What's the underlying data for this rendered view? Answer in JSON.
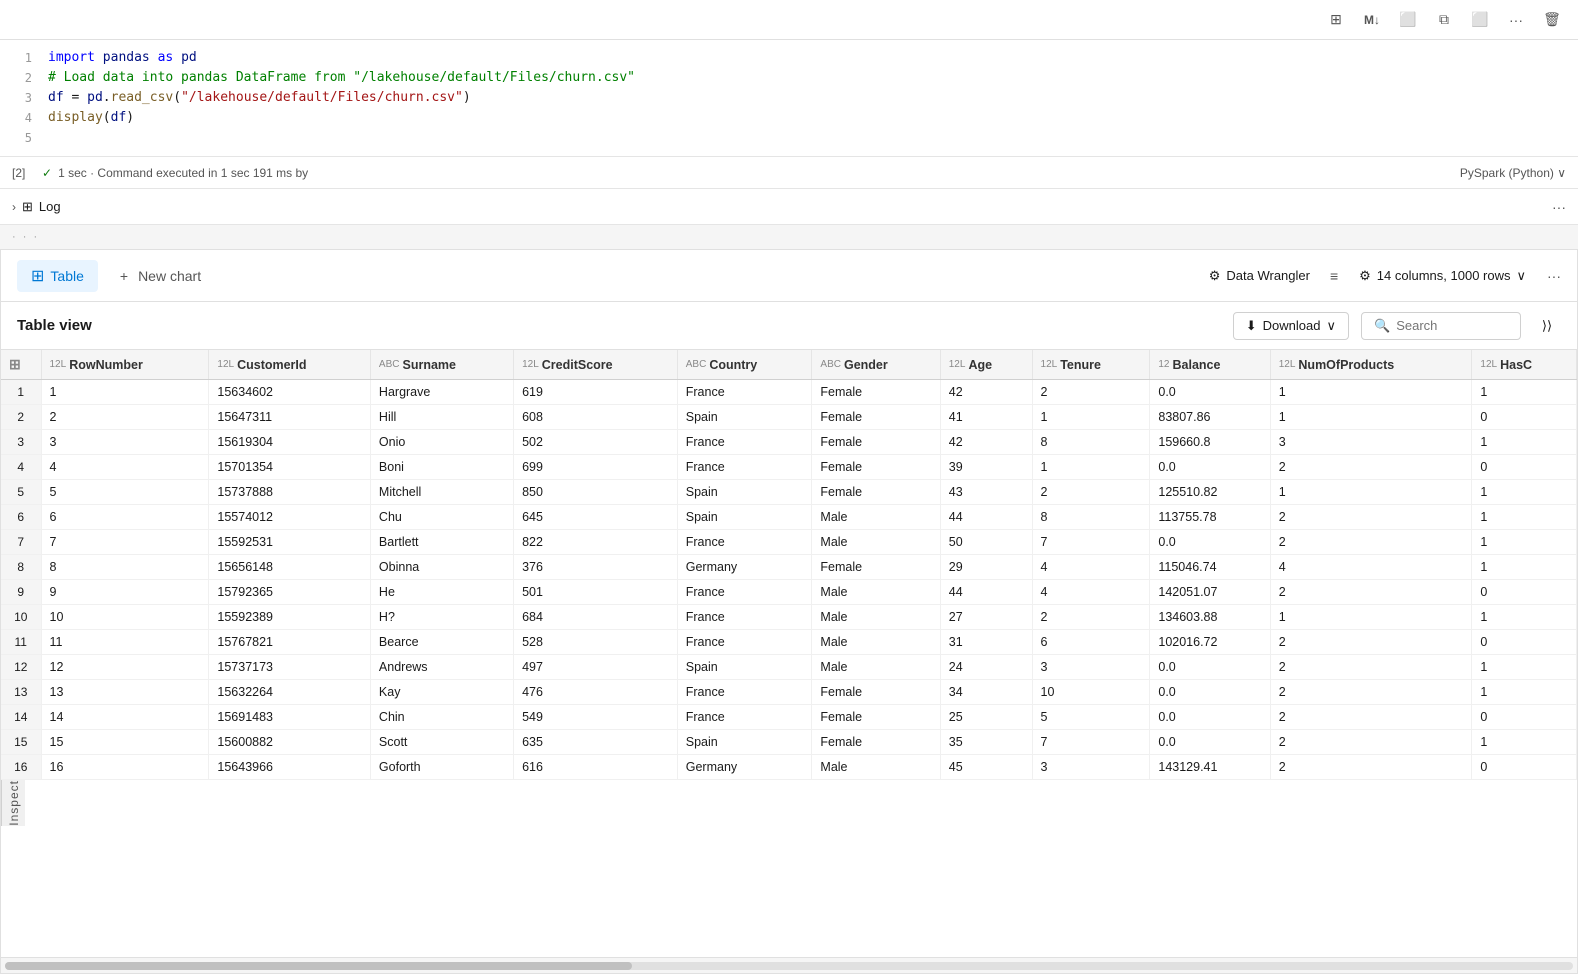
{
  "toolbar": {
    "icons": [
      "⊞",
      "Μ↓",
      "□",
      "⧉",
      "□→",
      "···",
      "🗑"
    ]
  },
  "cell": {
    "number": "[2]",
    "status": "✓  1 sec · Command executed in 1 sec 191 ms by",
    "pyspark": "PySpark (Python)  ∨",
    "lines": [
      {
        "num": 1,
        "tokens": [
          {
            "t": "kw",
            "v": "import "
          },
          {
            "t": "var",
            "v": "pandas"
          },
          {
            "t": "kw",
            "v": " as "
          },
          {
            "t": "var",
            "v": "pd"
          }
        ]
      },
      {
        "num": 2,
        "tokens": [
          {
            "t": "cm",
            "v": "# Load data into pandas DataFrame from \"/lakehouse/default/Files/churn.csv\""
          }
        ]
      },
      {
        "num": 3,
        "tokens": [
          {
            "t": "var",
            "v": "df"
          },
          {
            "t": "plain",
            "v": " = "
          },
          {
            "t": "var",
            "v": "pd"
          },
          {
            "t": "plain",
            "v": "."
          },
          {
            "t": "fn",
            "v": "read_csv"
          },
          {
            "t": "plain",
            "v": "("
          },
          {
            "t": "str",
            "v": "\"/lakehouse/default/Files/churn.csv\""
          },
          {
            "t": "plain",
            "v": ")"
          }
        ]
      },
      {
        "num": 4,
        "tokens": [
          {
            "t": "fn",
            "v": "display"
          },
          {
            "t": "plain",
            "v": "("
          },
          {
            "t": "var",
            "v": "df"
          },
          {
            "t": "plain",
            "v": ")"
          }
        ]
      },
      {
        "num": 5,
        "tokens": []
      }
    ]
  },
  "log": {
    "label": "Log",
    "more": "···"
  },
  "tabs": {
    "items": [
      {
        "id": "table",
        "label": "Table",
        "active": true,
        "icon": "⊞"
      },
      {
        "id": "new-chart",
        "label": "New chart",
        "active": false,
        "icon": "+"
      }
    ],
    "data_wrangler": "Data Wrangler",
    "columns_rows": "14 columns, 1000 rows",
    "more": "···"
  },
  "table_view": {
    "title": "Table view",
    "download": "Download",
    "search_placeholder": "Search"
  },
  "columns": [
    {
      "name": "RowNumber",
      "type": "12L"
    },
    {
      "name": "CustomerId",
      "type": "12L"
    },
    {
      "name": "Surname",
      "type": "ABC"
    },
    {
      "name": "CreditScore",
      "type": "12L"
    },
    {
      "name": "Country",
      "type": "ABC"
    },
    {
      "name": "Gender",
      "type": "ABC"
    },
    {
      "name": "Age",
      "type": "12L"
    },
    {
      "name": "Tenure",
      "type": "12L"
    },
    {
      "name": "Balance",
      "type": "12"
    },
    {
      "name": "NumOfProducts",
      "type": "12L"
    },
    {
      "name": "HasC",
      "type": "12L"
    }
  ],
  "rows": [
    [
      1,
      1,
      15634602,
      "Hargrave",
      619,
      "France",
      "Female",
      42,
      2,
      "0.0",
      1,
      1
    ],
    [
      2,
      2,
      15647311,
      "Hill",
      608,
      "Spain",
      "Female",
      41,
      1,
      "83807.86",
      1,
      0
    ],
    [
      3,
      3,
      15619304,
      "Onio",
      502,
      "France",
      "Female",
      42,
      8,
      "159660.8",
      3,
      1
    ],
    [
      4,
      4,
      15701354,
      "Boni",
      699,
      "France",
      "Female",
      39,
      1,
      "0.0",
      2,
      0
    ],
    [
      5,
      5,
      15737888,
      "Mitchell",
      850,
      "Spain",
      "Female",
      43,
      2,
      "125510.82",
      1,
      1
    ],
    [
      6,
      6,
      15574012,
      "Chu",
      645,
      "Spain",
      "Male",
      44,
      8,
      "113755.78",
      2,
      1
    ],
    [
      7,
      7,
      15592531,
      "Bartlett",
      822,
      "France",
      "Male",
      50,
      7,
      "0.0",
      2,
      1
    ],
    [
      8,
      8,
      15656148,
      "Obinna",
      376,
      "Germany",
      "Female",
      29,
      4,
      "115046.74",
      4,
      1
    ],
    [
      9,
      9,
      15792365,
      "He",
      501,
      "France",
      "Male",
      44,
      4,
      "142051.07",
      2,
      0
    ],
    [
      10,
      10,
      15592389,
      "H?",
      684,
      "France",
      "Male",
      27,
      2,
      "134603.88",
      1,
      1
    ],
    [
      11,
      11,
      15767821,
      "Bearce",
      528,
      "France",
      "Male",
      31,
      6,
      "102016.72",
      2,
      0
    ],
    [
      12,
      12,
      15737173,
      "Andrews",
      497,
      "Spain",
      "Male",
      24,
      3,
      "0.0",
      2,
      1
    ],
    [
      13,
      13,
      15632264,
      "Kay",
      476,
      "France",
      "Female",
      34,
      10,
      "0.0",
      2,
      1
    ],
    [
      14,
      14,
      15691483,
      "Chin",
      549,
      "France",
      "Female",
      25,
      5,
      "0.0",
      2,
      0
    ],
    [
      15,
      15,
      15600882,
      "Scott",
      635,
      "Spain",
      "Female",
      35,
      7,
      "0.0",
      2,
      1
    ],
    [
      16,
      16,
      15643966,
      "Goforth",
      616,
      "Germany",
      "Male",
      45,
      3,
      "143129.41",
      2,
      0
    ]
  ]
}
